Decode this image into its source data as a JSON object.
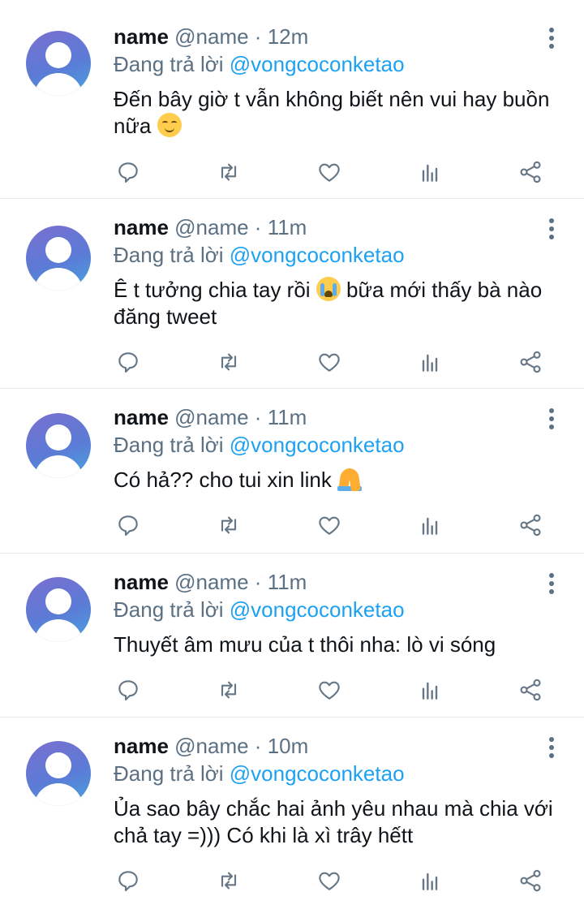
{
  "colors": {
    "text": "#0f1419",
    "secondary": "#5b7083",
    "mention": "#1da1f2",
    "divider": "#e6ecf0",
    "icon": "#657786"
  },
  "icons": {
    "reply": "reply-icon",
    "retweet": "retweet-icon",
    "like": "heart-icon",
    "stats": "analytics-icon",
    "share": "share-icon",
    "more": "more-vertical-icon"
  },
  "tweets": [
    {
      "name": "name",
      "meta": "@name · 12m",
      "reply_prefix": "Đang trả lời ",
      "reply_to": "@vongcoconketao",
      "text_before": "Đến bây giờ t vẫn không biết nên vui hay buồn nữa ",
      "emoji": "smile",
      "text_after": ""
    },
    {
      "name": "name",
      "meta": "@name · 11m",
      "reply_prefix": "Đang trả lời ",
      "reply_to": "@vongcoconketao",
      "text_before": "Ê t tưởng chia tay rồi ",
      "emoji": "cry",
      "text_after": " bữa mới thấy bà nào đăng tweet"
    },
    {
      "name": "name",
      "meta": "@name · 11m",
      "reply_prefix": "Đang trả lời ",
      "reply_to": "@vongcoconketao",
      "text_before": "Có hả?? cho tui xin link ",
      "emoji": "pray",
      "text_after": ""
    },
    {
      "name": "name",
      "meta": "@name · 11m",
      "reply_prefix": "Đang trả lời ",
      "reply_to": "@vongcoconketao",
      "text_before": "Thuyết âm mưu của t thôi nha: lò vi sóng",
      "emoji": "",
      "text_after": ""
    },
    {
      "name": "name",
      "meta": "@name · 10m",
      "reply_prefix": "Đang trả lời ",
      "reply_to": "@vongcoconketao",
      "text_before": "Ủa sao bây chắc hai ảnh yêu nhau mà chia với chả tay =))) Có khi là xì trây hếtt",
      "emoji": "",
      "text_after": ""
    }
  ]
}
